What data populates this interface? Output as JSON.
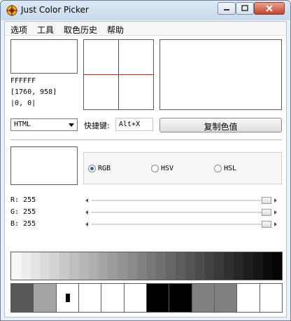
{
  "window": {
    "title": "Just Color Picker"
  },
  "menu": [
    "选项",
    "工具",
    "取色历史",
    "帮助"
  ],
  "current": {
    "hex": "FFFFFF",
    "position": "[1760, 958]",
    "offset": "|0, 0|",
    "color": "#ffffff"
  },
  "format_select": {
    "value": "HTML"
  },
  "shortcut": {
    "label": "快捷键:",
    "value": "Alt+X"
  },
  "copy_button": {
    "label": "复制色值"
  },
  "modes": [
    {
      "label": "RGB",
      "selected": true
    },
    {
      "label": "HSV",
      "selected": false
    },
    {
      "label": "HSL",
      "selected": false
    }
  ],
  "channels": [
    {
      "label": "R: 255",
      "value": 255,
      "max": 255
    },
    {
      "label": "G: 255",
      "value": 255,
      "max": 255
    },
    {
      "label": "B: 255",
      "value": 255,
      "max": 255
    }
  ],
  "gradient_colors": [
    "#f6f6f6",
    "#ededed",
    "#e4e4e4",
    "#dbdbdb",
    "#d2d2d2",
    "#c9c9c9",
    "#c0c0c0",
    "#b7b7b7",
    "#aeaeae",
    "#a5a5a5",
    "#9c9c9c",
    "#939393",
    "#8a8a8a",
    "#818181",
    "#787878",
    "#6f6f6f",
    "#666666",
    "#5d5d5d",
    "#545454",
    "#4b4b4b",
    "#424242",
    "#393939",
    "#303030",
    "#272727",
    "#1e1e1e",
    "#151515",
    "#0c0c0c",
    "#050505"
  ],
  "history_colors": [
    "#585858",
    "#a4a4a4",
    "#ffffff",
    "#ffffff",
    "#ffffff",
    "#ffffff",
    "#000000",
    "#000000",
    "#808080",
    "#808080",
    "#ffffff",
    "#ffffff"
  ]
}
